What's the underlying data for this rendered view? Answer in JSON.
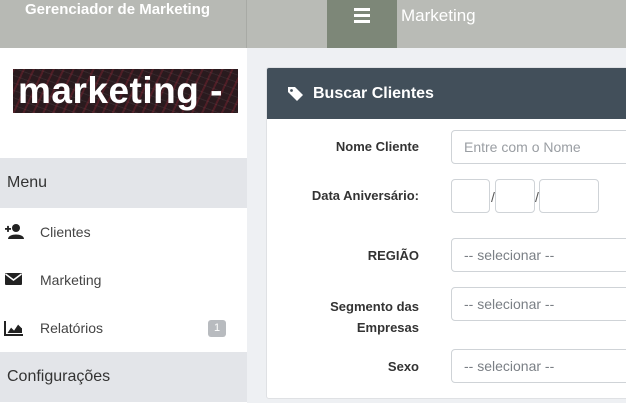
{
  "header": {
    "brand": "Gerenciador de Marketing",
    "page_title": "Marketing"
  },
  "logo": {
    "text": "marketing -"
  },
  "sidebar": {
    "menu_section": "Menu",
    "items": [
      {
        "label": "Clientes",
        "icon": "add-user-icon"
      },
      {
        "label": "Marketing",
        "icon": "envelope-icon"
      },
      {
        "label": "Relatórios",
        "icon": "area-chart-icon",
        "badge": "1"
      }
    ],
    "config_section": "Configurações"
  },
  "panel": {
    "title": "Buscar Clientes",
    "fields": {
      "nome_label": "Nome Cliente",
      "nome_placeholder": "Entre com o Nome",
      "data_label": "Data Aniversário:",
      "date_separator": "/",
      "regiao_label": "REGIÃO",
      "regiao_value": "-- selecionar --",
      "segmento_label_1": "Segmento das",
      "segmento_label_2": "Empresas",
      "segmento_value": "-- selecionar --",
      "sexo_label": "Sexo",
      "sexo_value": "-- selecionar --"
    }
  }
}
